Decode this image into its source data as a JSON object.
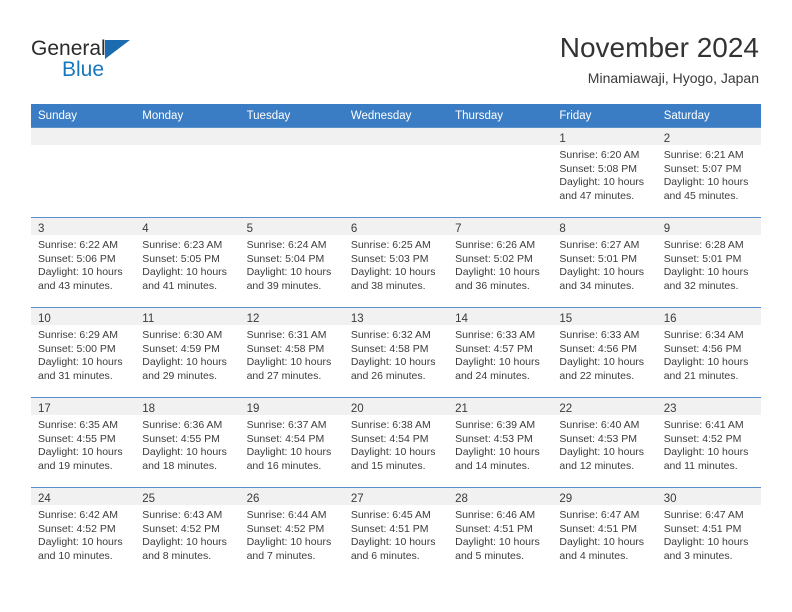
{
  "brand": {
    "line1": "General",
    "line2": "Blue",
    "triangle_color": "#1a6bb0"
  },
  "header": {
    "title": "November 2024",
    "subtitle": "Minamiawaji, Hyogo, Japan"
  },
  "theme": {
    "header_bg": "#3b7dc4",
    "daynum_band_bg": "#f1f1f1",
    "cell_border": "#5b8fc9",
    "text": "#3c3c3c"
  },
  "calendar": {
    "weekday_headers": [
      "Sunday",
      "Monday",
      "Tuesday",
      "Wednesday",
      "Thursday",
      "Friday",
      "Saturday"
    ],
    "weeks": [
      [
        {
          "day": "",
          "lines": []
        },
        {
          "day": "",
          "lines": []
        },
        {
          "day": "",
          "lines": []
        },
        {
          "day": "",
          "lines": []
        },
        {
          "day": "",
          "lines": []
        },
        {
          "day": "1",
          "lines": [
            "Sunrise: 6:20 AM",
            "Sunset: 5:08 PM",
            "Daylight: 10 hours and 47 minutes."
          ]
        },
        {
          "day": "2",
          "lines": [
            "Sunrise: 6:21 AM",
            "Sunset: 5:07 PM",
            "Daylight: 10 hours and 45 minutes."
          ]
        }
      ],
      [
        {
          "day": "3",
          "lines": [
            "Sunrise: 6:22 AM",
            "Sunset: 5:06 PM",
            "Daylight: 10 hours and 43 minutes."
          ]
        },
        {
          "day": "4",
          "lines": [
            "Sunrise: 6:23 AM",
            "Sunset: 5:05 PM",
            "Daylight: 10 hours and 41 minutes."
          ]
        },
        {
          "day": "5",
          "lines": [
            "Sunrise: 6:24 AM",
            "Sunset: 5:04 PM",
            "Daylight: 10 hours and 39 minutes."
          ]
        },
        {
          "day": "6",
          "lines": [
            "Sunrise: 6:25 AM",
            "Sunset: 5:03 PM",
            "Daylight: 10 hours and 38 minutes."
          ]
        },
        {
          "day": "7",
          "lines": [
            "Sunrise: 6:26 AM",
            "Sunset: 5:02 PM",
            "Daylight: 10 hours and 36 minutes."
          ]
        },
        {
          "day": "8",
          "lines": [
            "Sunrise: 6:27 AM",
            "Sunset: 5:01 PM",
            "Daylight: 10 hours and 34 minutes."
          ]
        },
        {
          "day": "9",
          "lines": [
            "Sunrise: 6:28 AM",
            "Sunset: 5:01 PM",
            "Daylight: 10 hours and 32 minutes."
          ]
        }
      ],
      [
        {
          "day": "10",
          "lines": [
            "Sunrise: 6:29 AM",
            "Sunset: 5:00 PM",
            "Daylight: 10 hours and 31 minutes."
          ]
        },
        {
          "day": "11",
          "lines": [
            "Sunrise: 6:30 AM",
            "Sunset: 4:59 PM",
            "Daylight: 10 hours and 29 minutes."
          ]
        },
        {
          "day": "12",
          "lines": [
            "Sunrise: 6:31 AM",
            "Sunset: 4:58 PM",
            "Daylight: 10 hours and 27 minutes."
          ]
        },
        {
          "day": "13",
          "lines": [
            "Sunrise: 6:32 AM",
            "Sunset: 4:58 PM",
            "Daylight: 10 hours and 26 minutes."
          ]
        },
        {
          "day": "14",
          "lines": [
            "Sunrise: 6:33 AM",
            "Sunset: 4:57 PM",
            "Daylight: 10 hours and 24 minutes."
          ]
        },
        {
          "day": "15",
          "lines": [
            "Sunrise: 6:33 AM",
            "Sunset: 4:56 PM",
            "Daylight: 10 hours and 22 minutes."
          ]
        },
        {
          "day": "16",
          "lines": [
            "Sunrise: 6:34 AM",
            "Sunset: 4:56 PM",
            "Daylight: 10 hours and 21 minutes."
          ]
        }
      ],
      [
        {
          "day": "17",
          "lines": [
            "Sunrise: 6:35 AM",
            "Sunset: 4:55 PM",
            "Daylight: 10 hours and 19 minutes."
          ]
        },
        {
          "day": "18",
          "lines": [
            "Sunrise: 6:36 AM",
            "Sunset: 4:55 PM",
            "Daylight: 10 hours and 18 minutes."
          ]
        },
        {
          "day": "19",
          "lines": [
            "Sunrise: 6:37 AM",
            "Sunset: 4:54 PM",
            "Daylight: 10 hours and 16 minutes."
          ]
        },
        {
          "day": "20",
          "lines": [
            "Sunrise: 6:38 AM",
            "Sunset: 4:54 PM",
            "Daylight: 10 hours and 15 minutes."
          ]
        },
        {
          "day": "21",
          "lines": [
            "Sunrise: 6:39 AM",
            "Sunset: 4:53 PM",
            "Daylight: 10 hours and 14 minutes."
          ]
        },
        {
          "day": "22",
          "lines": [
            "Sunrise: 6:40 AM",
            "Sunset: 4:53 PM",
            "Daylight: 10 hours and 12 minutes."
          ]
        },
        {
          "day": "23",
          "lines": [
            "Sunrise: 6:41 AM",
            "Sunset: 4:52 PM",
            "Daylight: 10 hours and 11 minutes."
          ]
        }
      ],
      [
        {
          "day": "24",
          "lines": [
            "Sunrise: 6:42 AM",
            "Sunset: 4:52 PM",
            "Daylight: 10 hours and 10 minutes."
          ]
        },
        {
          "day": "25",
          "lines": [
            "Sunrise: 6:43 AM",
            "Sunset: 4:52 PM",
            "Daylight: 10 hours and 8 minutes."
          ]
        },
        {
          "day": "26",
          "lines": [
            "Sunrise: 6:44 AM",
            "Sunset: 4:52 PM",
            "Daylight: 10 hours and 7 minutes."
          ]
        },
        {
          "day": "27",
          "lines": [
            "Sunrise: 6:45 AM",
            "Sunset: 4:51 PM",
            "Daylight: 10 hours and 6 minutes."
          ]
        },
        {
          "day": "28",
          "lines": [
            "Sunrise: 6:46 AM",
            "Sunset: 4:51 PM",
            "Daylight: 10 hours and 5 minutes."
          ]
        },
        {
          "day": "29",
          "lines": [
            "Sunrise: 6:47 AM",
            "Sunset: 4:51 PM",
            "Daylight: 10 hours and 4 minutes."
          ]
        },
        {
          "day": "30",
          "lines": [
            "Sunrise: 6:47 AM",
            "Sunset: 4:51 PM",
            "Daylight: 10 hours and 3 minutes."
          ]
        }
      ]
    ]
  }
}
